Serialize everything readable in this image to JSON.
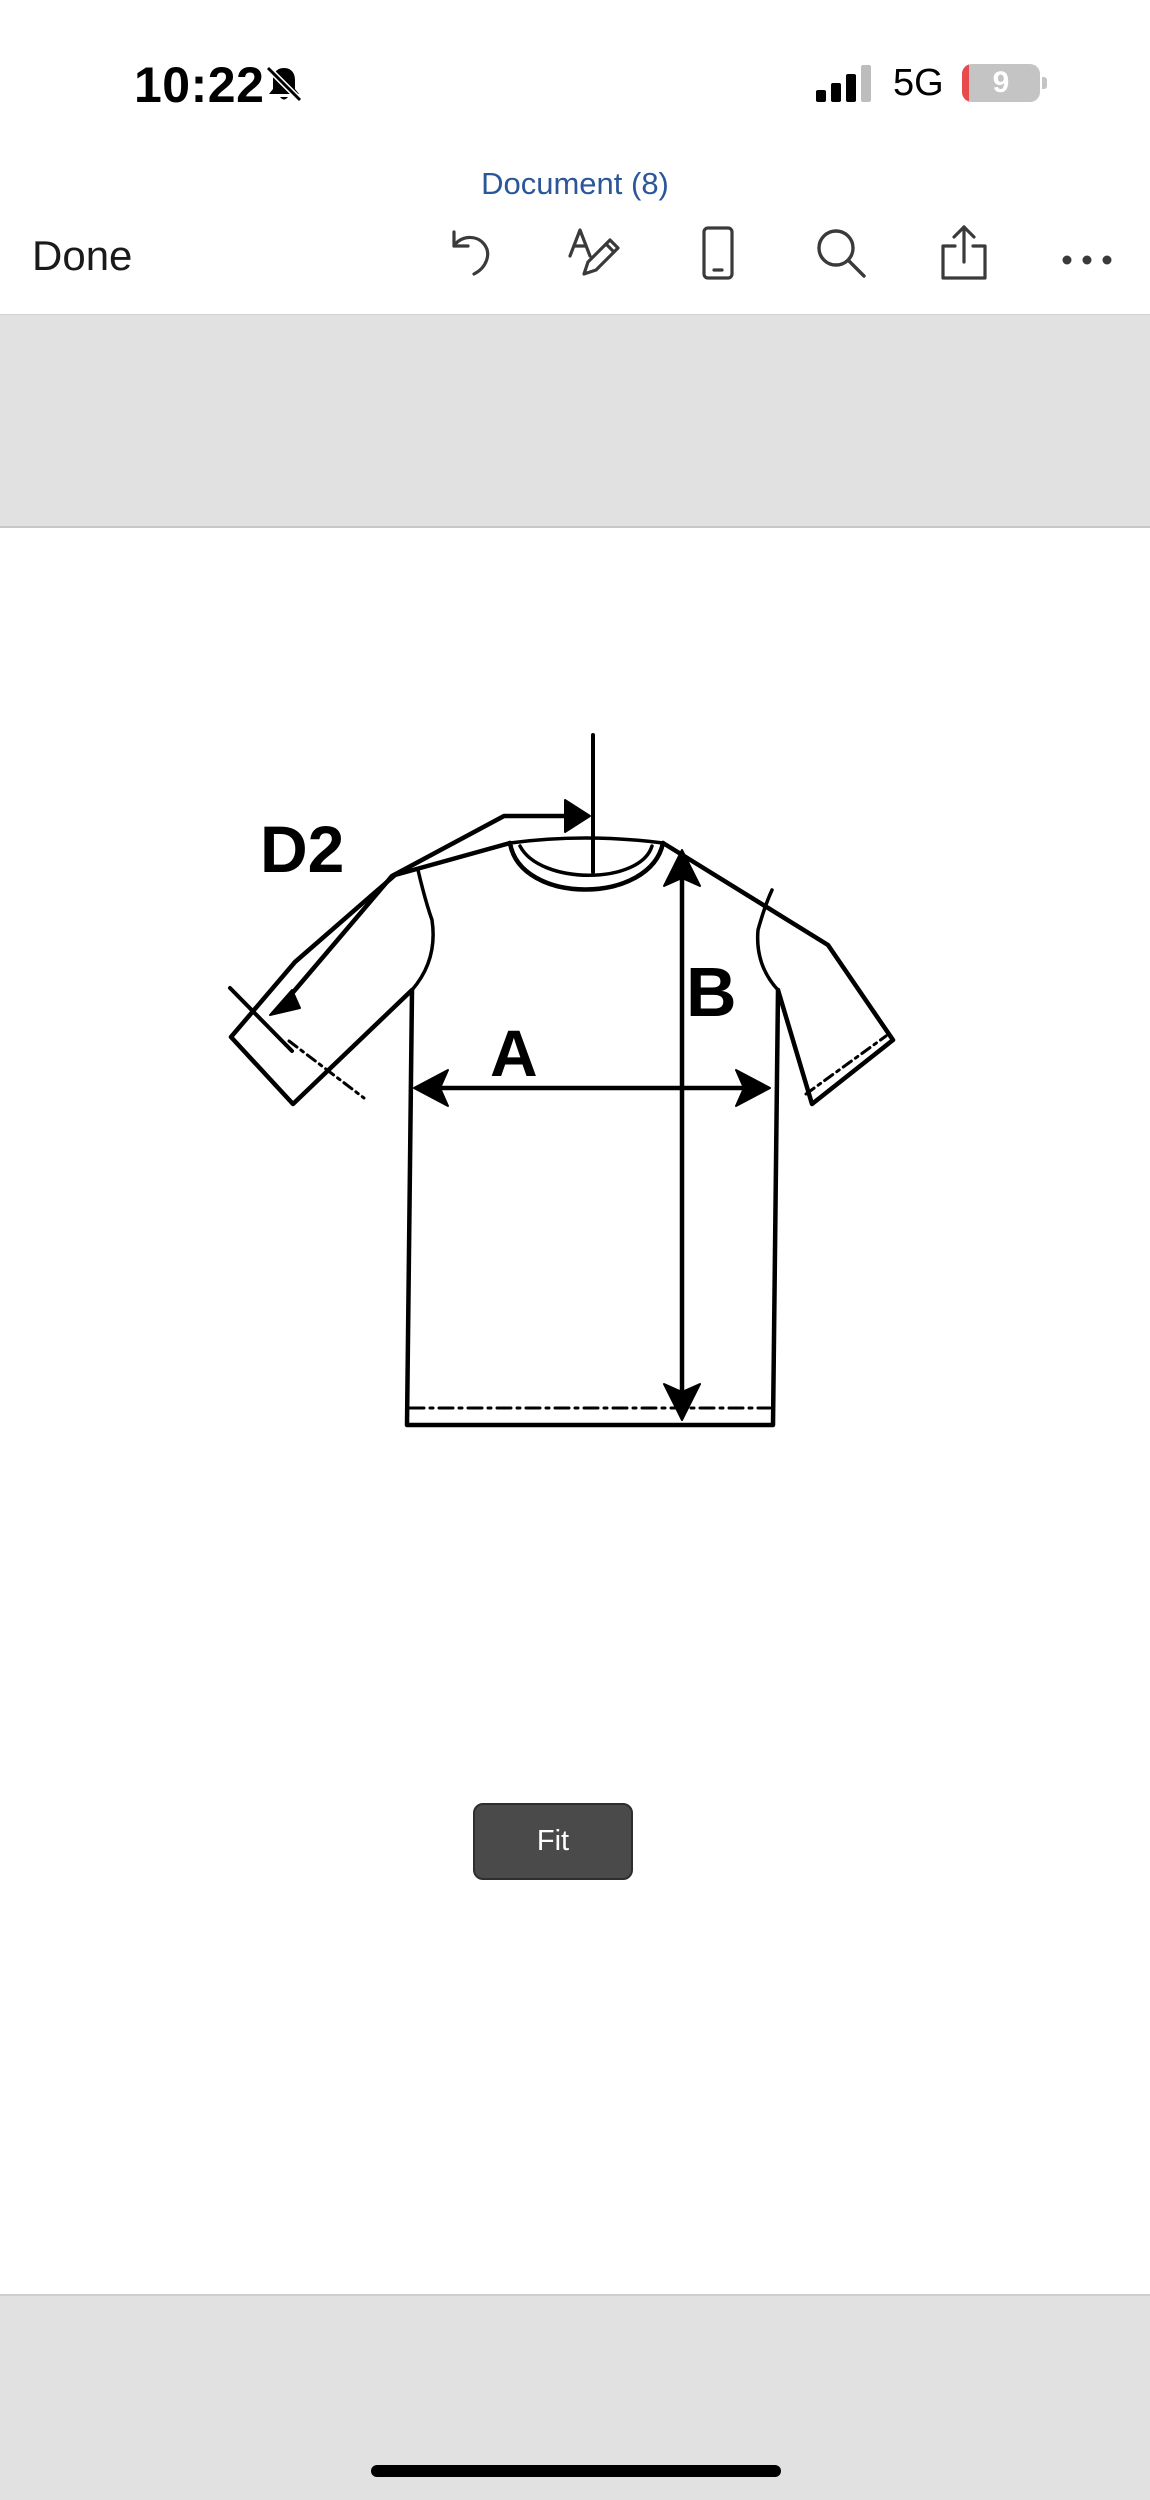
{
  "status_bar": {
    "time": "10:22",
    "network": "5G",
    "battery_level": "9",
    "battery_fraction": 0.09,
    "icons": [
      "bell-slash-icon",
      "cellular-signal-icon",
      "battery-icon"
    ]
  },
  "toolbar": {
    "document_title": "Document (8)",
    "done_label": "Done",
    "icons": [
      "undo-icon",
      "draw-pen-icon",
      "mobile-view-icon",
      "search-icon",
      "share-icon",
      "more-icon"
    ]
  },
  "diagram": {
    "labels": {
      "sleeve": "D2",
      "chest": "A",
      "length": "B"
    }
  },
  "fit_button": {
    "label": "Fit"
  },
  "colors": {
    "title_blue": "#2b579a",
    "chrome_gray": "#e1e1e1",
    "button_dark": "#4a4a4a",
    "battery_red": "#e84b4b"
  }
}
